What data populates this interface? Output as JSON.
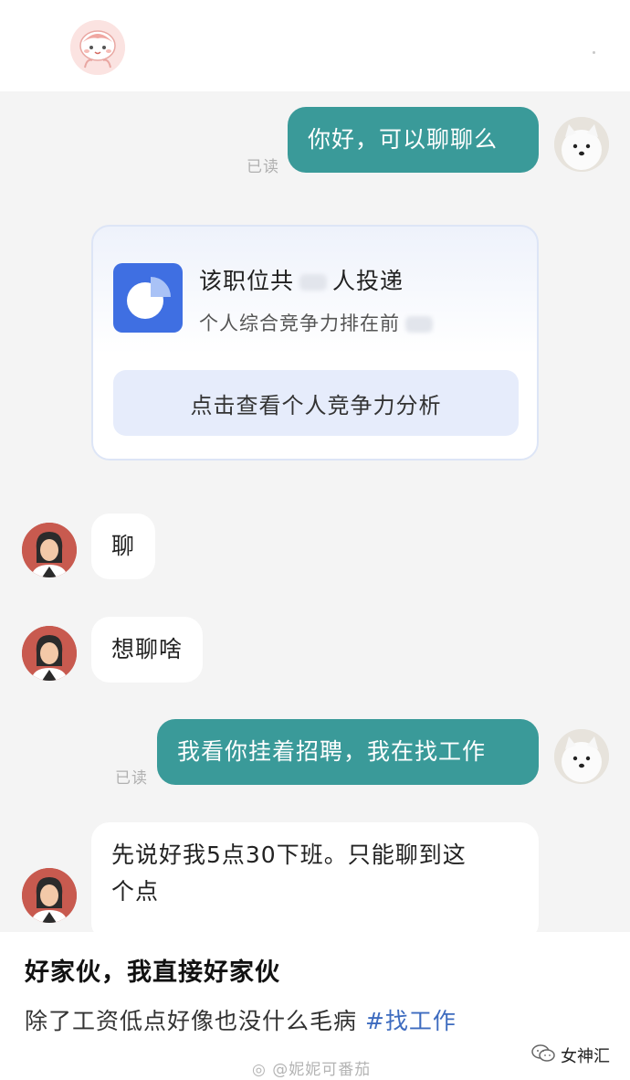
{
  "messages": {
    "m1": {
      "text": "你好，可以聊聊么",
      "status": "已读"
    },
    "job_card": {
      "line1_prefix": "该职位共",
      "line1_suffix": "人投递",
      "line2_prefix": "个人综合竞争力排在前",
      "button_label": "点击查看个人竞争力分析"
    },
    "m2": {
      "text": "聊"
    },
    "m3": {
      "text": "想聊啥"
    },
    "m4": {
      "text": "我看你挂着招聘，我在找工作",
      "status": "已读"
    },
    "m5": {
      "line1": "先说好我5点30下班。只能聊到这",
      "line2": "个点"
    }
  },
  "post": {
    "title": "好家伙，我直接好家伙",
    "body": "除了工资低点好像也没什么毛病",
    "tag": "#找工作",
    "watermark": "@妮妮可番茄",
    "brand": "女神汇"
  },
  "colors": {
    "sent_bubble": "#3a9a99",
    "received_bubble": "#ffffff",
    "chat_background": "#f4f4f4",
    "card_icon": "#3f6fe2",
    "tag": "#3d6bbf"
  },
  "icons": {
    "top_avatar": "cartoon-avatar-icon",
    "my_avatar": "samoyed-dog-avatar-icon",
    "recruiter_avatar": "woman-avatar-icon",
    "card_icon": "pie-chart-icon",
    "brand_icon": "wechat-icon",
    "watermark_icon": "weibo-icon"
  }
}
